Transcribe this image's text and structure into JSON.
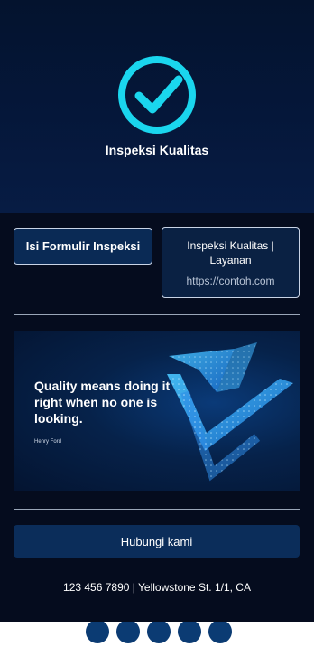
{
  "hero": {
    "logo_icon": "check-circle-icon",
    "title": "Inspeksi Kualitas",
    "accent_color": "#1ad6ee"
  },
  "actions": {
    "form_button_label": "Isi Formulir Inspeksi",
    "link_card": {
      "title": "Inspeksi Kualitas | Layanan",
      "url": "https://contoh.com"
    }
  },
  "banner": {
    "quote": "Quality means doing it right when no one is looking.",
    "author": "Henry Ford",
    "graphic_icon": "checkmark-shield-icon"
  },
  "contact": {
    "button_label": "Hubungi kami",
    "info": "123 456 7890 | Yellowstone St. 1/1, CA"
  },
  "social": {
    "icons": [
      "social-icon-1",
      "social-icon-2",
      "social-icon-3",
      "social-icon-4",
      "social-icon-5"
    ]
  }
}
